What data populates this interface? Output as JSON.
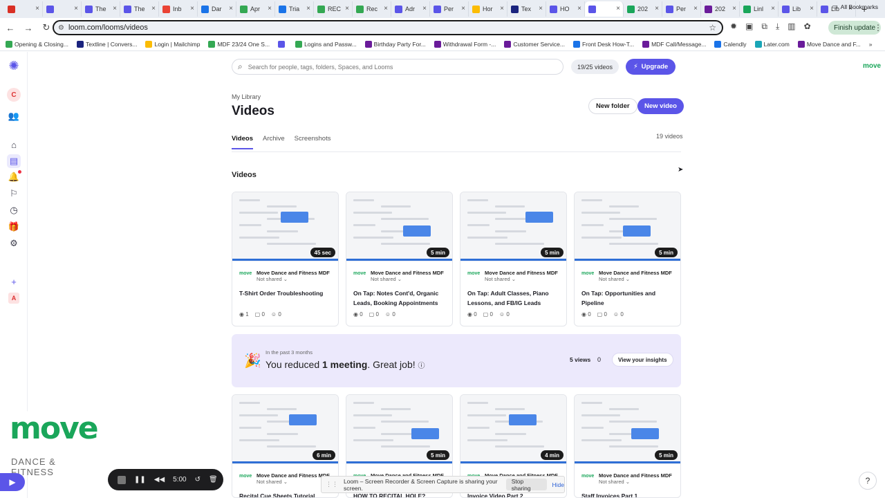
{
  "browser": {
    "tabs": [
      {
        "label": "",
        "color": "#d93025"
      },
      {
        "label": "",
        "color": "#5b55e8"
      },
      {
        "label": "The",
        "color": "#5b55e8"
      },
      {
        "label": "The",
        "color": "#5b55e8"
      },
      {
        "label": "Inb",
        "color": "#ea4335"
      },
      {
        "label": "Dar",
        "color": "#1a73e8"
      },
      {
        "label": "Apr",
        "color": "#34a853"
      },
      {
        "label": "Tria",
        "color": "#1a73e8"
      },
      {
        "label": "REC",
        "color": "#34a853"
      },
      {
        "label": "Rec",
        "color": "#34a853"
      },
      {
        "label": "Adr",
        "color": "#5b55e8"
      },
      {
        "label": "Per",
        "color": "#5b55e8"
      },
      {
        "label": "Hor",
        "color": "#fbbc04"
      },
      {
        "label": "Tex",
        "color": "#1a237e"
      },
      {
        "label": "HO",
        "color": "#5b55e8"
      },
      {
        "label": "",
        "color": "#5b55e8",
        "active": true
      },
      {
        "label": "202",
        "color": "#1aa65a"
      },
      {
        "label": "Per",
        "color": "#5b55e8"
      },
      {
        "label": "202",
        "color": "#6a1b9a"
      },
      {
        "label": "Linl",
        "color": "#1aa65a"
      },
      {
        "label": "Lib",
        "color": "#5b55e8"
      },
      {
        "label": "Lib",
        "color": "#5b55e8"
      }
    ],
    "url": "loom.com/looms/videos",
    "finish_update": "Finish update",
    "bookmarks": [
      {
        "label": "Opening & Closing...",
        "color": "#34a853"
      },
      {
        "label": "Textline | Convers...",
        "color": "#1a237e"
      },
      {
        "label": "Login | Mailchimp",
        "color": "#fbbc04"
      },
      {
        "label": "MDF 23/24 One S...",
        "color": "#34a853"
      },
      {
        "label": "",
        "color": "#5b55e8"
      },
      {
        "label": "Logins and Passw...",
        "color": "#34a853"
      },
      {
        "label": "Birthday Party For...",
        "color": "#6a1b9a"
      },
      {
        "label": "Withdrawal Form -...",
        "color": "#6a1b9a"
      },
      {
        "label": "Customer Service...",
        "color": "#6a1b9a"
      },
      {
        "label": "Front Desk How-T...",
        "color": "#1a73e8"
      },
      {
        "label": "MDF Call/Message...",
        "color": "#6a1b9a"
      },
      {
        "label": "Calendly",
        "color": "#1a73e8"
      },
      {
        "label": "Later.com",
        "color": "#1aa6b7"
      },
      {
        "label": "Move Dance and F...",
        "color": "#6a1b9a"
      }
    ],
    "all_bookmarks": "All Bookmarks"
  },
  "rail": {
    "avatar": "C",
    "workspace": "A"
  },
  "search": {
    "placeholder": "Search for people, tags, folders, Spaces, and Looms"
  },
  "header": {
    "quota": "19/25 videos",
    "upgrade": "Upgrade",
    "brand": "move",
    "breadcrumb": "My Library",
    "title": "Videos",
    "new_folder": "New folder",
    "new_video": "New video"
  },
  "tabs": [
    {
      "label": "Videos",
      "active": true
    },
    {
      "label": "Archive"
    },
    {
      "label": "Screenshots"
    }
  ],
  "video_count": "19 videos",
  "section_title": "Videos",
  "owner_name": "Move Dance and Fitness MDF",
  "shared_text": "Not shared",
  "videos": [
    {
      "title": "T-Shirt Order Troubleshooting",
      "duration": "45 sec",
      "views": "1",
      "comments": "0",
      "reactions": "0"
    },
    {
      "title": "On Tap: Notes Cont'd, Organic Leads, Booking Appointments",
      "duration": "5 min",
      "views": "0",
      "comments": "0",
      "reactions": "0"
    },
    {
      "title": "On Tap: Adult Classes, Piano Lessons, and FB/IG Leads",
      "duration": "5 min",
      "views": "0",
      "comments": "0",
      "reactions": "0"
    },
    {
      "title": "On Tap: Opportunities and Pipeline",
      "duration": "5 min",
      "views": "0",
      "comments": "0",
      "reactions": "0"
    },
    {
      "title": "Recital Cue Sheets Tutorial",
      "duration": "6 min"
    },
    {
      "title": "HOW TO RECITAL HOLE?",
      "duration": "5 min"
    },
    {
      "title": "Invoice Video Part 2",
      "duration": "4 min"
    },
    {
      "title": "Staff Invoices Part 1",
      "duration": "5 min"
    }
  ],
  "banner": {
    "subtitle": "In the past 3 months",
    "message_pre": "You reduced ",
    "message_bold": "1 meeting",
    "message_post": ". Great job!",
    "views": "5 views",
    "meetings": "0",
    "insights": "View your insights"
  },
  "overlay": {
    "logo_main": "move",
    "logo_sub": "DANCE & FITNESS",
    "timer": "5:00",
    "share_text": "Loom – Screen Recorder & Screen Capture is sharing your screen.",
    "stop_sharing": "Stop sharing",
    "hide": "Hide",
    "help": "?"
  }
}
